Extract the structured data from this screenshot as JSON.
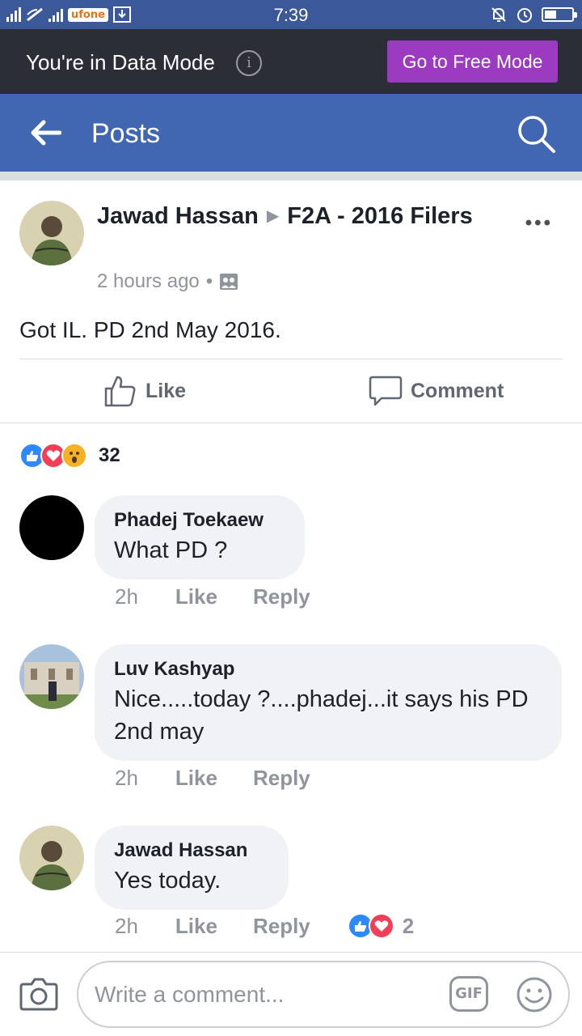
{
  "status_bar": {
    "carrier": "ufone",
    "time": "7:39",
    "battery_level": 0.45
  },
  "mode_bar": {
    "text": "You're in Data Mode",
    "info_icon": "info-icon",
    "button_label": "Go to Free Mode",
    "button_color": "#9c3bc2"
  },
  "header": {
    "title": "Posts",
    "back_icon": "arrow-left-icon",
    "search_icon": "search-icon",
    "color": "#4267b2"
  },
  "post": {
    "author": "Jawad Hassan",
    "group": "F2A - 2016 Filers",
    "time": "2 hours ago",
    "separator": "•",
    "audience_icon": "group-icon",
    "text": "Got IL. PD 2nd May 2016.",
    "actions": {
      "like": "Like",
      "comment": "Comment"
    },
    "reactions": {
      "types": [
        "like",
        "love",
        "wow"
      ],
      "count": "32"
    }
  },
  "comments": [
    {
      "name": "Phadej Toekaew",
      "text": "What PD ?",
      "time": "2h",
      "like": "Like",
      "reply": "Reply"
    },
    {
      "name": "Luv Kashyap",
      "text": "Nice.....today ?....phadej...it says his PD 2nd may",
      "time": "2h",
      "like": "Like",
      "reply": "Reply"
    },
    {
      "name": "Jawad Hassan",
      "text": "Yes today.",
      "time": "2h",
      "like": "Like",
      "reply": "Reply",
      "reactions": {
        "types": [
          "like",
          "love"
        ],
        "count": "2"
      }
    }
  ],
  "composer": {
    "placeholder": "Write a comment...",
    "camera_icon": "camera-icon",
    "gif_label": "GIF",
    "emoji_icon": "smiley-icon"
  }
}
